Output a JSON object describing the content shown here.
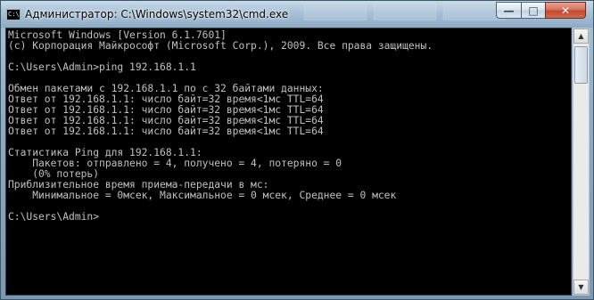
{
  "window": {
    "title": "Администратор: C:\\Windows\\system32\\cmd.exe",
    "app_icon_text": "C:\\",
    "min_glyph": "—",
    "max_glyph": "□",
    "close_glyph": "✕"
  },
  "console": {
    "lines": [
      "Microsoft Windows [Version 6.1.7601]",
      "(c) Корпорация Майкрософт (Microsoft Corp.), 2009. Все права защищены.",
      "",
      "C:\\Users\\Admin>ping 192.168.1.1",
      "",
      "Обмен пакетами с 192.168.1.1 по с 32 байтами данных:",
      "Ответ от 192.168.1.1: число байт=32 время<1мс TTL=64",
      "Ответ от 192.168.1.1: число байт=32 время<1мс TTL=64",
      "Ответ от 192.168.1.1: число байт=32 время<1мс TTL=64",
      "Ответ от 192.168.1.1: число байт=32 время<1мс TTL=64",
      "",
      "Статистика Ping для 192.168.1.1:",
      "    Пакетов: отправлено = 4, получено = 4, потеряно = 0",
      "    (0% потерь)",
      "Приблизительное время приема-передачи в мс:",
      "    Минимальное = 0мсек, Максимальное = 0 мсек, Среднее = 0 мсек",
      "",
      "C:\\Users\\Admin>"
    ]
  },
  "scrollbar": {
    "up_glyph": "▲",
    "down_glyph": "▼",
    "position": 0
  },
  "colors": {
    "console_bg": "#000000",
    "console_fg": "#c0c0c0",
    "close_button": "#c24a2f"
  }
}
